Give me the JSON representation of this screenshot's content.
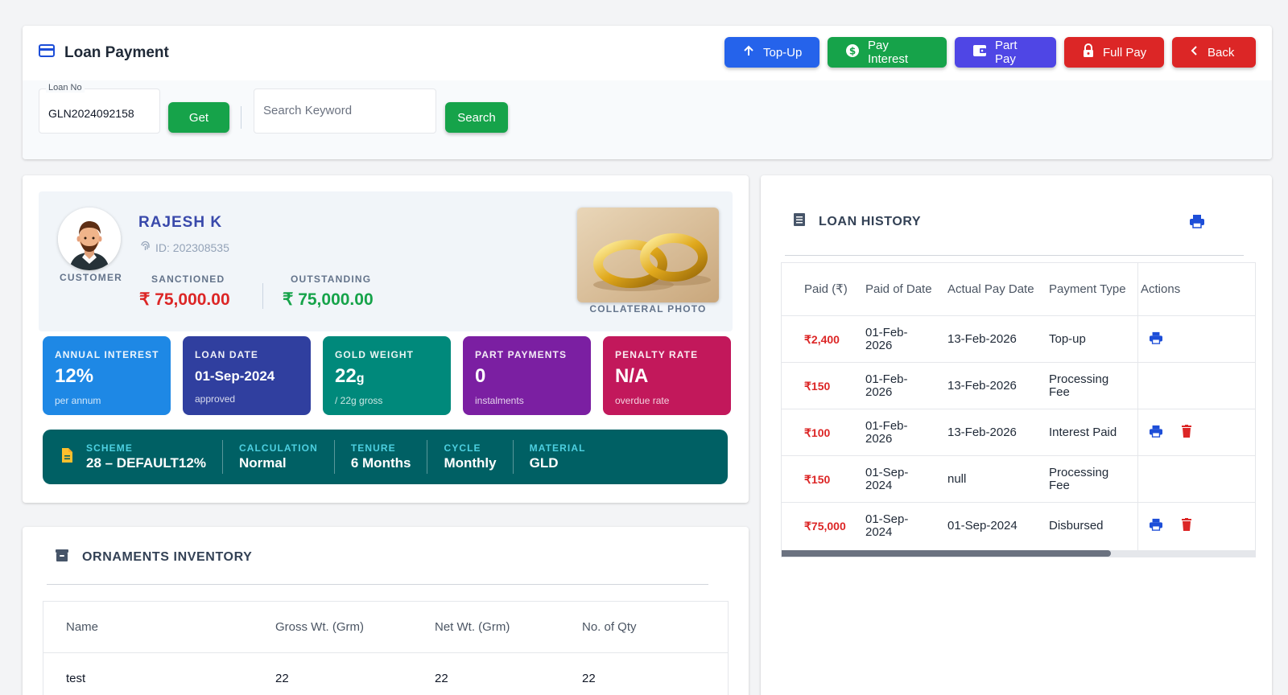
{
  "page": {
    "title": "Loan Payment",
    "actions": [
      {
        "label": "Top-Up",
        "color": "#2563eb",
        "icon": "arrow-up-icon"
      },
      {
        "label": "Pay Interest",
        "color": "#16a34a",
        "icon": "dollar-circle-icon"
      },
      {
        "label": "Part Pay",
        "color": "#4f46e5",
        "icon": "wallet-icon"
      },
      {
        "label": "Full Pay",
        "color": "#dc2626",
        "icon": "lock-icon"
      },
      {
        "label": "Back",
        "color": "#dc2626",
        "icon": "chevron-left-icon"
      }
    ]
  },
  "filters": {
    "loan_no_label": "Loan No",
    "loan_no_value": "GLN2024092158",
    "get_label": "Get",
    "search_placeholder": "Search Keyword",
    "search_label": "Search"
  },
  "customer": {
    "name": "RAJESH K",
    "id_text": "ID: 202308535",
    "caption": "CUSTOMER",
    "sanctioned_label": "SANCTIONED",
    "sanctioned_value": "₹ 75,000.00",
    "outstanding_label": "OUTSTANDING",
    "outstanding_value": "₹ 75,000.00",
    "photo_caption": "COLLATERAL PHOTO"
  },
  "stats": [
    {
      "label": "ANNUAL INTEREST",
      "value": "12%",
      "unit": "",
      "sub": "per annum",
      "color": "#1e88e5"
    },
    {
      "label": "LOAN DATE",
      "value": "01-Sep-2024",
      "unit": "",
      "sub": "approved",
      "color": "#303f9f"
    },
    {
      "label": "GOLD WEIGHT",
      "value": "22",
      "unit": "g",
      "sub": "/ 22g gross",
      "color": "#00897b"
    },
    {
      "label": "PART PAYMENTS",
      "value": "0",
      "unit": "",
      "sub": "instalments",
      "color": "#7b1fa2"
    },
    {
      "label": "PENALTY RATE",
      "value": "N/A",
      "unit": "",
      "sub": "overdue rate",
      "color": "#c2185b"
    }
  ],
  "scheme": [
    {
      "key": "SCHEME",
      "value": "28 – DEFAULT12%"
    },
    {
      "key": "CALCULATION",
      "value": "Normal"
    },
    {
      "key": "TENURE",
      "value": "6 Months"
    },
    {
      "key": "CYCLE",
      "value": "Monthly"
    },
    {
      "key": "MATERIAL",
      "value": "GLD"
    }
  ],
  "ornaments": {
    "title": "ORNAMENTS INVENTORY",
    "columns": [
      "Name",
      "Gross Wt. (Grm)",
      "Net Wt. (Grm)",
      "No. of Qty"
    ],
    "rows": [
      [
        "test",
        "22",
        "22",
        "22"
      ]
    ]
  },
  "history": {
    "title": "LOAN HISTORY",
    "columns": [
      "Paid (₹)",
      "Paid of Date",
      "Actual Pay Date",
      "Payment Type",
      "Actions"
    ],
    "rows": [
      {
        "paid": "₹2,400",
        "paid_date_1": "01-Feb-",
        "paid_date_2": "2026",
        "actual": "13-Feb-2026",
        "type_1": "Top-up",
        "type_2": "",
        "print": true,
        "delete": false
      },
      {
        "paid": "₹150",
        "paid_date_1": "01-Feb-",
        "paid_date_2": "2026",
        "actual": "13-Feb-2026",
        "type_1": "Processing",
        "type_2": "Fee",
        "print": false,
        "delete": false
      },
      {
        "paid": "₹100",
        "paid_date_1": "01-Feb-",
        "paid_date_2": "2026",
        "actual": "13-Feb-2026",
        "type_1": "Interest Paid",
        "type_2": "",
        "print": true,
        "delete": true
      },
      {
        "paid": "₹150",
        "paid_date_1": "01-Sep-",
        "paid_date_2": "2024",
        "actual": "null",
        "type_1": "Processing",
        "type_2": "Fee",
        "print": false,
        "delete": false
      },
      {
        "paid": "₹75,000",
        "paid_date_1": "01-Sep-",
        "paid_date_2": "2024",
        "actual": "01-Sep-2024",
        "type_1": "Disbursed",
        "type_2": "",
        "print": true,
        "delete": true
      }
    ]
  }
}
